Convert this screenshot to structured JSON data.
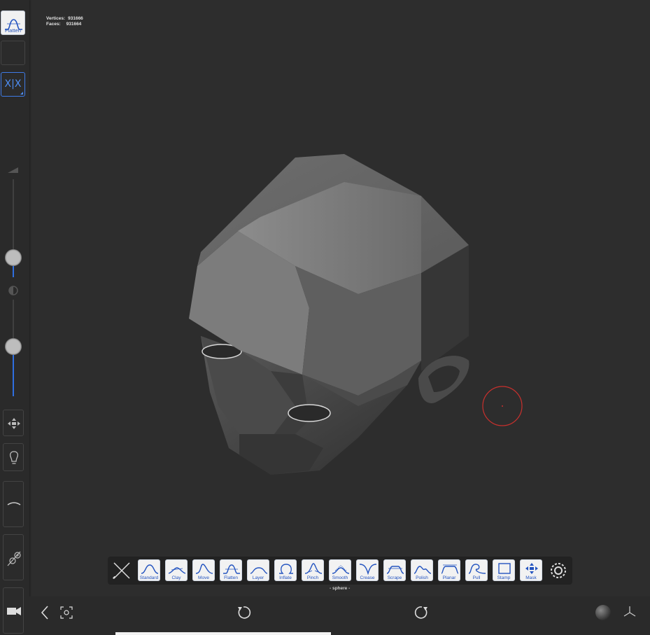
{
  "stats": {
    "vertices_label": "Vertices:",
    "vertices_value": "931666",
    "faces_label": "Faces:",
    "faces_value": "931664"
  },
  "sidebar": {
    "tool_label": "Flatten",
    "symmetry_label": "X|X",
    "radius_level": 0.55,
    "intensity_level": 0.6
  },
  "brushes": [
    {
      "label": "Standard"
    },
    {
      "label": "Clay"
    },
    {
      "label": "Move"
    },
    {
      "label": "Flatten"
    },
    {
      "label": "Layer"
    },
    {
      "label": "Inflate"
    },
    {
      "label": "Pinch"
    },
    {
      "label": "Smooth"
    },
    {
      "label": "Crease"
    },
    {
      "label": "Scrape"
    },
    {
      "label": "Polish"
    },
    {
      "label": "Planar"
    },
    {
      "label": "Pull"
    },
    {
      "label": "Stamp"
    },
    {
      "label": "Mask"
    }
  ],
  "mesh_name": "- sphere -",
  "colors": {
    "accent": "#3f7be6",
    "cursor": "#c8302d",
    "background": "#2d2d2d"
  },
  "icons": {
    "back": "chevron-left-icon",
    "frame": "focus-frame-icon",
    "undo": "undo-icon",
    "redo": "redo-icon",
    "material": "matcap-sphere-icon",
    "axes": "axes-icon",
    "camera": "camera-icon",
    "light": "lightbulb-icon",
    "move": "move-arrows-icon",
    "curve": "curve-icon",
    "dynamic": "dynamic-topology-icon",
    "brush_tool": "brush-cross-icon",
    "settings": "settings-gear-icon"
  }
}
